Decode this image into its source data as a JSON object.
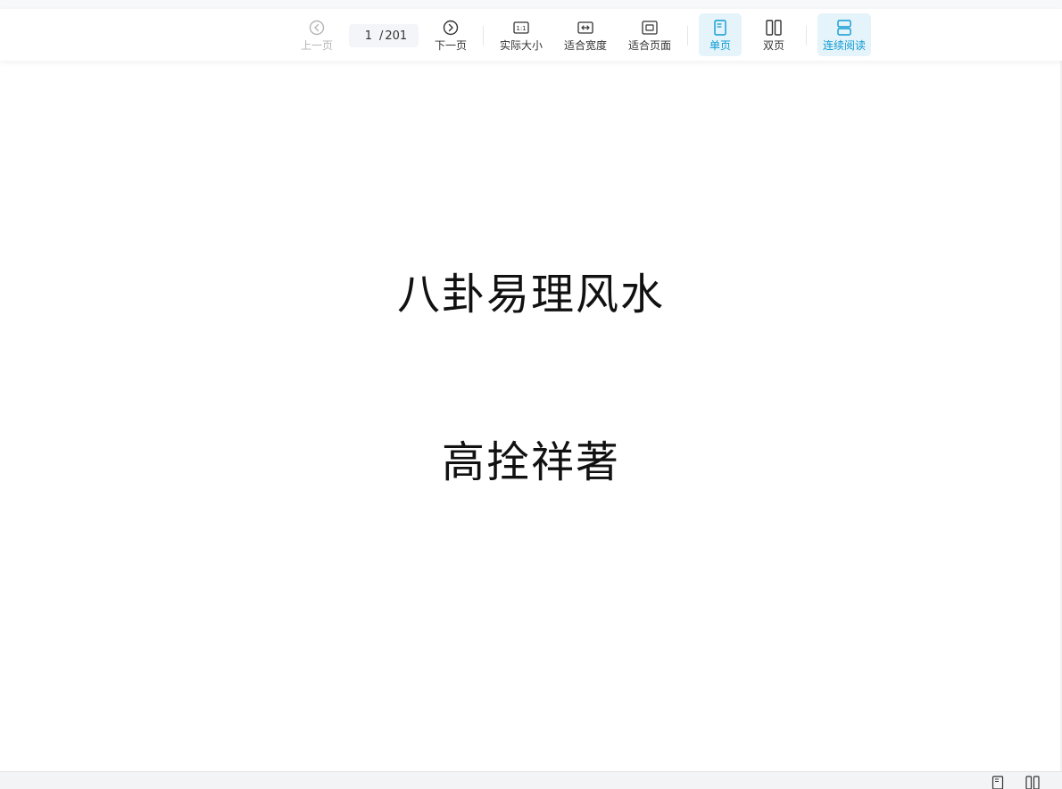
{
  "toolbar": {
    "prev_label": "上一页",
    "next_label": "下一页",
    "current_page": "1",
    "page_separator": "/",
    "total_pages": "201",
    "actual_size_label": "实际大小",
    "fit_width_label": "适合宽度",
    "fit_page_label": "适合页面",
    "single_page_label": "单页",
    "double_page_label": "双页",
    "continuous_label": "连续阅读",
    "actual_size_icon_text": "1:1"
  },
  "document": {
    "title": "八卦易理风水",
    "author": "高拴祥著"
  },
  "icons": {
    "prev": "chevron-left-circle-icon",
    "next": "chevron-right-circle-icon",
    "actual_size": "one-to-one-icon",
    "fit_width": "fit-width-icon",
    "fit_page": "fit-page-icon",
    "single_page": "single-page-icon",
    "double_page": "double-page-icon",
    "continuous": "continuous-scroll-icon"
  },
  "colors": {
    "accent": "#0e9bd3",
    "active_bg": "#e5f3fa",
    "disabled": "#b5b5b5"
  }
}
